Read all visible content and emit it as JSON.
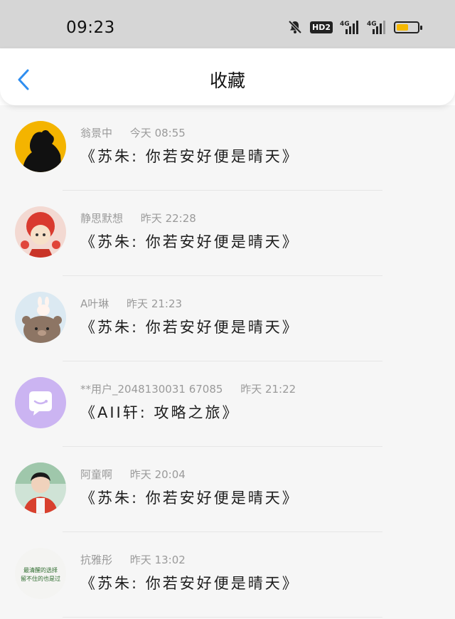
{
  "status_bar": {
    "time": "09:23",
    "hd_badge": "HD2",
    "net1": "4G",
    "net2": "4G",
    "battery_percent": 64
  },
  "header": {
    "title": "收藏"
  },
  "items": [
    {
      "username": "翁景中",
      "time": "今天 08:55",
      "message": "《苏朱: 你若安好便是晴天》"
    },
    {
      "username": "静思默想",
      "time": "昨天 22:28",
      "message": "《苏朱: 你若安好便是晴天》"
    },
    {
      "username": "A叶琳",
      "time": "昨天 21:23",
      "message": "《苏朱: 你若安好便是晴天》"
    },
    {
      "username": "**用户_2048130031 67085",
      "time": "昨天 21:22",
      "message": "《AII轩: 攻略之旅》"
    },
    {
      "username": "阿童啊",
      "time": "昨天 20:04",
      "message": "《苏朱: 你若安好便是晴天》"
    },
    {
      "username": "抗雅彤",
      "time": "昨天 13:02",
      "message": "《苏朱: 你若安好便是晴天》"
    }
  ],
  "avatar6_text": "最清醒的选择\n留不住的也是过"
}
